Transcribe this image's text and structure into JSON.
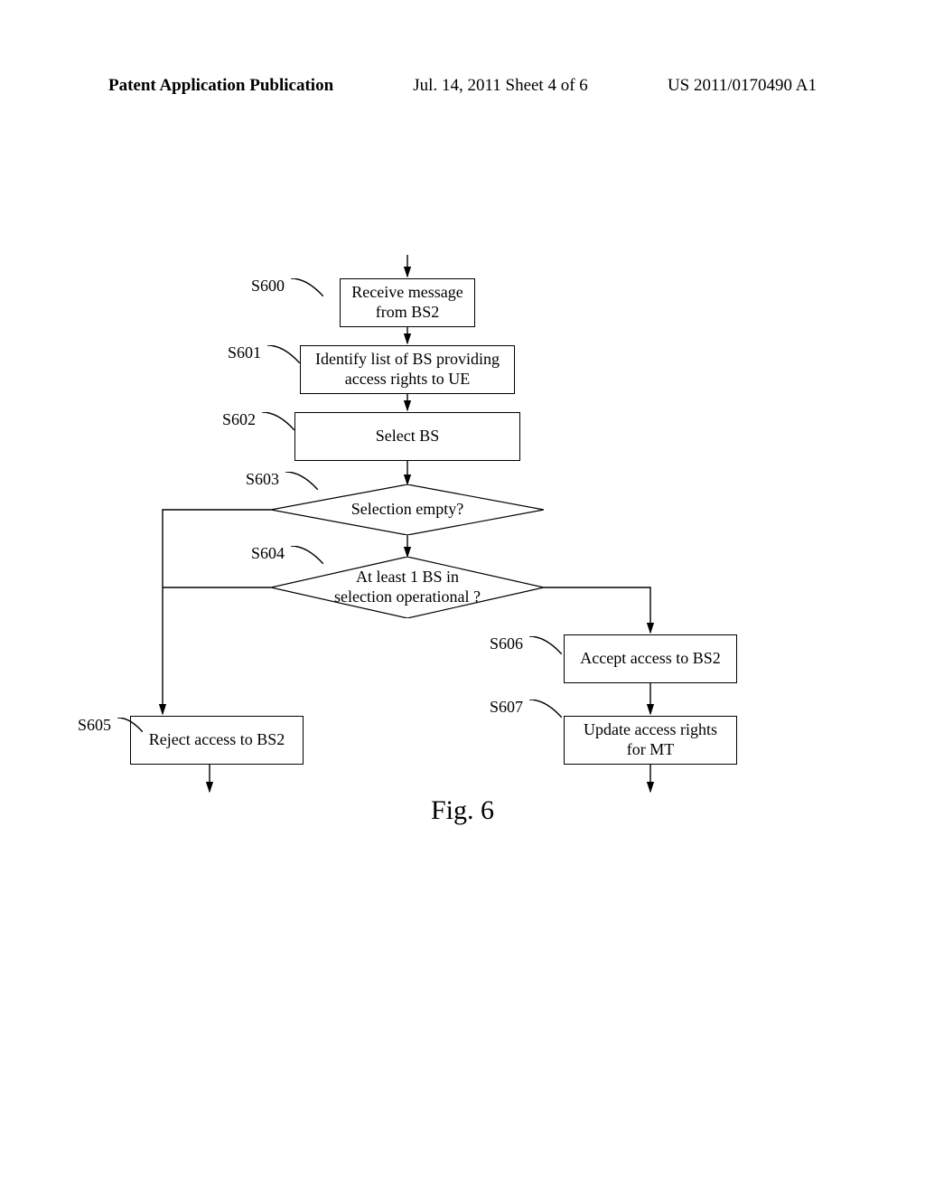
{
  "header": {
    "left": "Patent Application Publication",
    "mid": "Jul. 14, 2011  Sheet 4 of 6",
    "right": "US 2011/0170490 A1"
  },
  "labels": {
    "s600": "S600",
    "s601": "S601",
    "s602": "S602",
    "s603": "S603",
    "s604": "S604",
    "s605": "S605",
    "s606": "S606",
    "s607": "S607"
  },
  "nodes": {
    "n600": "Receive message\nfrom BS2",
    "n601": "Identify list of BS providing\naccess rights to UE",
    "n602": "Select BS",
    "n603": "Selection empty?",
    "n604": "At least 1 BS in\nselection operational ?",
    "n605": "Reject access to BS2",
    "n606": "Accept access to BS2",
    "n607": "Update access rights\nfor MT"
  },
  "caption": "Fig. 6"
}
